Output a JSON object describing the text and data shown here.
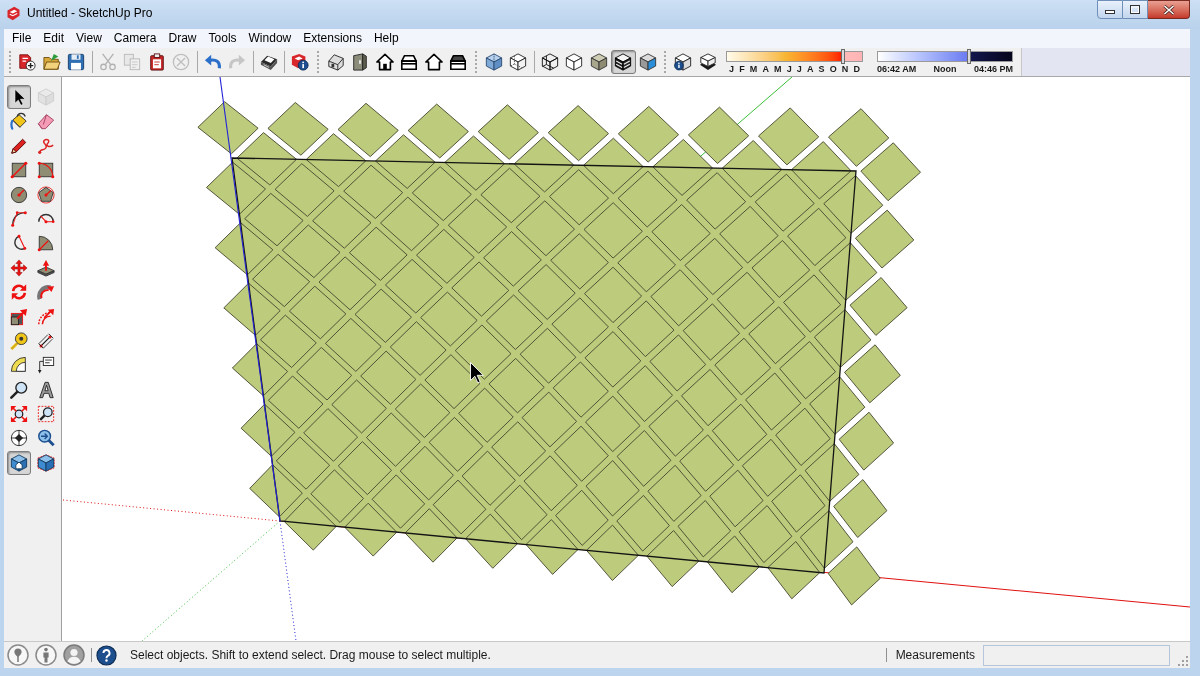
{
  "window": {
    "title": "Untitled - SketchUp Pro"
  },
  "menu": [
    "File",
    "Edit",
    "View",
    "Camera",
    "Draw",
    "Tools",
    "Window",
    "Extensions",
    "Help"
  ],
  "toolbars": [
    {
      "sections": [
        [
          {
            "kind": "new",
            "selected": false,
            "disabled": false
          },
          {
            "kind": "open",
            "selected": false,
            "disabled": false
          },
          {
            "kind": "save",
            "selected": false,
            "disabled": false
          }
        ],
        [
          {
            "kind": "cut",
            "selected": false,
            "disabled": true
          },
          {
            "kind": "copy",
            "selected": false,
            "disabled": true
          },
          {
            "kind": "paste",
            "selected": false,
            "disabled": false
          },
          {
            "kind": "erase",
            "selected": false,
            "disabled": true
          }
        ],
        [
          {
            "kind": "undo",
            "selected": false,
            "disabled": false
          },
          {
            "kind": "redo",
            "selected": false,
            "disabled": true
          }
        ],
        [
          {
            "kind": "print",
            "selected": false,
            "disabled": false
          }
        ],
        [
          {
            "kind": "info",
            "selected": false,
            "disabled": false
          }
        ]
      ]
    },
    {
      "sections": [
        [
          {
            "kind": "iso",
            "selected": false,
            "disabled": false
          },
          {
            "kind": "top",
            "selected": false,
            "disabled": false
          },
          {
            "kind": "front",
            "selected": false,
            "disabled": false
          },
          {
            "kind": "right",
            "selected": false,
            "disabled": false
          },
          {
            "kind": "back",
            "selected": false,
            "disabled": false
          },
          {
            "kind": "left",
            "selected": false,
            "disabled": false
          }
        ]
      ]
    },
    {
      "sections": [
        [
          {
            "kind": "xray",
            "selected": false,
            "disabled": false
          },
          {
            "kind": "backedges",
            "selected": false,
            "disabled": false
          }
        ],
        [
          {
            "kind": "wireframe",
            "selected": false,
            "disabled": false
          },
          {
            "kind": "hiddenline",
            "selected": false,
            "disabled": false
          },
          {
            "kind": "shaded",
            "selected": false,
            "disabled": false
          },
          {
            "kind": "textured",
            "selected": true,
            "disabled": false
          },
          {
            "kind": "monochrome",
            "selected": false,
            "disabled": false
          }
        ]
      ]
    },
    {
      "sections": [
        [
          {
            "kind": "shadowinfo",
            "selected": false,
            "disabled": false
          },
          {
            "kind": "shadows",
            "selected": false,
            "disabled": false
          }
        ]
      ],
      "sliders": [
        {
          "kind": "month",
          "level": 0.86,
          "labels": [
            "J",
            "F",
            "M",
            "A",
            "M",
            "J",
            "J",
            "A",
            "S",
            "O",
            "N",
            "D"
          ]
        },
        {
          "kind": "time",
          "level": 0.68,
          "labels": [
            "06:42 AM",
            "Noon",
            "04:46 PM"
          ]
        }
      ]
    }
  ],
  "tools": [
    {
      "kind": "select",
      "selected": true,
      "disabled": false
    },
    {
      "kind": "component",
      "selected": false,
      "disabled": true
    },
    {
      "kind": "paint",
      "selected": false,
      "disabled": false
    },
    {
      "kind": "eraser",
      "selected": false,
      "disabled": false
    },
    {
      "kind": "line",
      "selected": false,
      "disabled": false
    },
    {
      "kind": "freehand",
      "selected": false,
      "disabled": false
    },
    {
      "kind": "rectangle",
      "selected": false,
      "disabled": false
    },
    {
      "kind": "rotrect",
      "selected": false,
      "disabled": false
    },
    {
      "kind": "circle",
      "selected": false,
      "disabled": false
    },
    {
      "kind": "polygon",
      "selected": false,
      "disabled": false
    },
    {
      "kind": "arcpoint",
      "selected": false,
      "disabled": false
    },
    {
      "kind": "arcthree",
      "selected": false,
      "disabled": false
    },
    {
      "kind": "arccenter",
      "selected": false,
      "disabled": false
    },
    {
      "kind": "pie",
      "selected": false,
      "disabled": false
    },
    {
      "kind": "move",
      "selected": false,
      "disabled": false
    },
    {
      "kind": "pushpull",
      "selected": false,
      "disabled": false
    },
    {
      "kind": "rotate",
      "selected": false,
      "disabled": false
    },
    {
      "kind": "followme",
      "selected": false,
      "disabled": false
    },
    {
      "kind": "scale",
      "selected": false,
      "disabled": false
    },
    {
      "kind": "offset",
      "selected": false,
      "disabled": false
    },
    {
      "kind": "tape",
      "selected": false,
      "disabled": false
    },
    {
      "kind": "dimension",
      "selected": false,
      "disabled": false
    },
    {
      "kind": "protractor",
      "selected": false,
      "disabled": false
    },
    {
      "kind": "text",
      "selected": false,
      "disabled": false
    },
    {
      "kind": "zoom",
      "selected": false,
      "disabled": false
    },
    {
      "kind": "textthree",
      "selected": false,
      "disabled": false
    },
    {
      "kind": "zoomextents",
      "selected": false,
      "disabled": false
    },
    {
      "kind": "zoomwindow",
      "selected": false,
      "disabled": false
    },
    {
      "kind": "position",
      "selected": false,
      "disabled": false
    },
    {
      "kind": "lookaround",
      "selected": false,
      "disabled": false
    },
    {
      "kind": "walk",
      "selected": true,
      "disabled": false
    },
    {
      "kind": "section",
      "selected": false,
      "disabled": false
    }
  ],
  "status_bar": {
    "message": "Select objects. Shift to extend select. Drag mouse to select multiple.",
    "measurements_label": "Measurements"
  }
}
